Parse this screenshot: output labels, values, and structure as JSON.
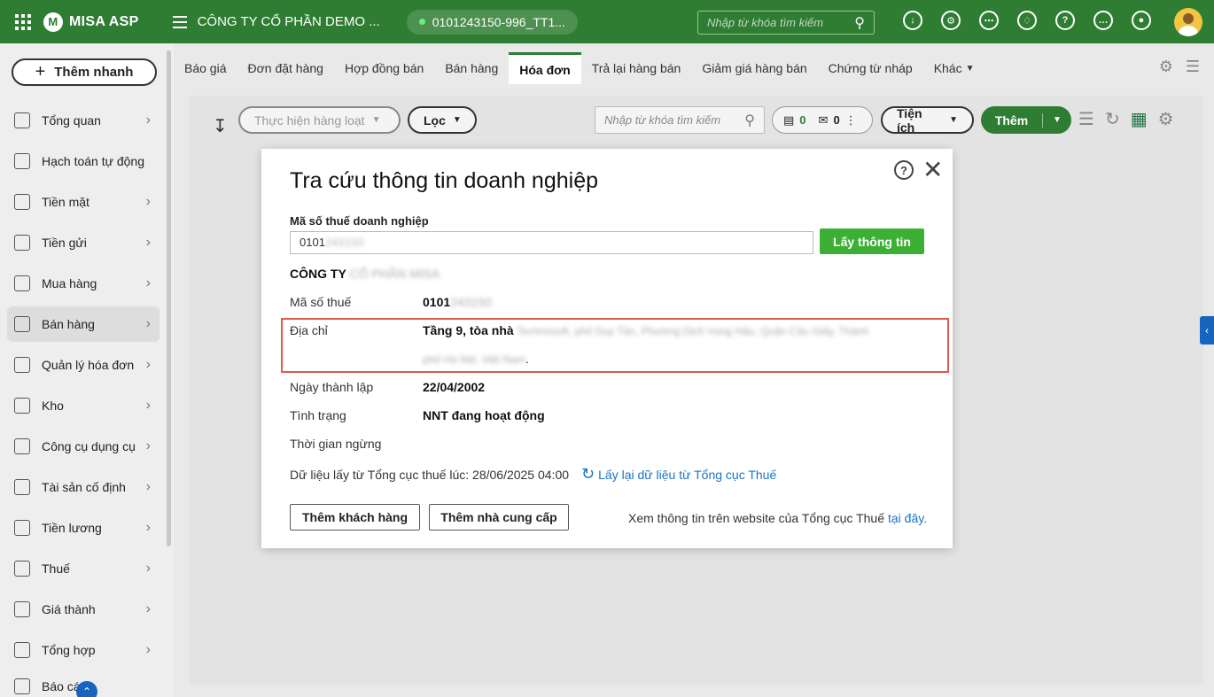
{
  "header": {
    "logo_text": "MISA ASP",
    "company": "CÔNG TY CỔ PHẦN DEMO ...",
    "tax_pill": "0101243150-996_TT1...",
    "search_placeholder": "Nhập từ khóa tìm kiếm"
  },
  "sidebar": {
    "quick_add": "Thêm nhanh",
    "items": [
      {
        "label": "Tổng quan",
        "icon": "monitor-icon"
      },
      {
        "label": "Hạch toán tự động",
        "icon": "auto-gear-icon"
      },
      {
        "label": "Tiền mặt",
        "icon": "money-bag-icon"
      },
      {
        "label": "Tiền gửi",
        "icon": "bank-icon"
      },
      {
        "label": "Mua hàng",
        "icon": "shopping-bag-icon"
      },
      {
        "label": "Bán hàng",
        "icon": "cart-icon"
      },
      {
        "label": "Quản lý hóa đơn",
        "icon": "invoice-icon"
      },
      {
        "label": "Kho",
        "icon": "warehouse-icon"
      },
      {
        "label": "Công cụ dụng cụ",
        "icon": "tools-icon"
      },
      {
        "label": "Tài sản cố định",
        "icon": "car-icon"
      },
      {
        "label": "Tiền lương",
        "icon": "salary-icon"
      },
      {
        "label": "Thuế",
        "icon": "tax-icon"
      },
      {
        "label": "Giá thành",
        "icon": "price-tag-icon"
      },
      {
        "label": "Tổng hợp",
        "icon": "report-icon"
      },
      {
        "label": "Báo cá",
        "icon": "chart-report-icon"
      }
    ]
  },
  "tabs": [
    {
      "label": "Báo giá"
    },
    {
      "label": "Đơn đặt hàng"
    },
    {
      "label": "Hợp đồng bán"
    },
    {
      "label": "Bán hàng"
    },
    {
      "label": "Hóa đơn",
      "active": true
    },
    {
      "label": "Trả lại hàng bán"
    },
    {
      "label": "Giảm giá hàng bán"
    },
    {
      "label": "Chứng từ nháp"
    },
    {
      "label": "Khác"
    }
  ],
  "toolbar": {
    "batch_action": "Thực hiện hàng loạt",
    "filter": "Lọc",
    "search_placeholder": "Nhập từ khóa tìm kiếm",
    "doc_count": "0",
    "mail_count": "0",
    "utilities": "Tiện ích",
    "add": "Thêm"
  },
  "dialog": {
    "title": "Tra cứu thông tin doanh nghiệp",
    "tax_label": "Mã số thuế doanh nghiệp",
    "tax_value_visible": "0101",
    "tax_value_blurred": "243150",
    "fetch_button": "Lấy thông tin",
    "company_prefix": "CÔNG TY",
    "company_blurred": "CỔ PHẦN MISA",
    "rows": {
      "tax_code_label": "Mã số thuế",
      "tax_code_visible": "0101",
      "tax_code_blurred": "243150",
      "address_label": "Địa chỉ",
      "address_visible": "Tầng 9, tòa nhà",
      "address_blurred_1": "Technosoft, phố Duy Tân, Phường Dịch Vọng Hậu, Quận Cầu Giấy, Thành",
      "address_blurred_2": "phố Hà Nội, Việt Nam",
      "address_end": ".",
      "founded_label": "Ngày thành lập",
      "founded_value": "22/04/2002",
      "status_label": "Tình trạng",
      "status_value": "NNT đang hoạt động",
      "suspend_label": "Thời gian ngừng"
    },
    "source_text": "Dữ liệu lấy từ Tổng cục thuế lúc: 28/06/2025 04:00",
    "refresh_link": "Lấy lại dữ liệu từ Tổng cục Thuế",
    "add_customer": "Thêm khách hàng",
    "add_supplier": "Thêm nhà cung cấp",
    "web_note": "Xem thông tin trên website của Tổng cục Thuế",
    "web_link": "tại đây."
  }
}
